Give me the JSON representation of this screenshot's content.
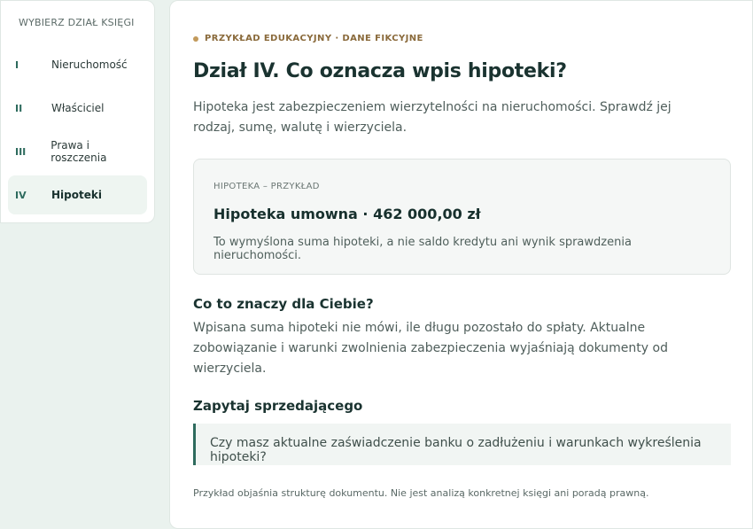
{
  "sidebar": {
    "title": "WYBIERZ DZIAŁ KSIĘGI",
    "items": [
      {
        "num": "I",
        "label": "Nieruchomość"
      },
      {
        "num": "II",
        "label": "Właściciel"
      },
      {
        "num": "III",
        "label": "Prawa i roszczenia"
      },
      {
        "num": "IV",
        "label": "Hipoteki",
        "active": true
      }
    ]
  },
  "main": {
    "eyebrow": "PRZYKŁAD EDUKACYJNY · DANE FIKCYJNE",
    "title": "Dział IV. Co oznacza wpis hipoteki?",
    "intro": "Hipoteka jest zabezpieczeniem wierzytelności na nieruchomości. Sprawdź jej rodzaj, sumę, walutę i wierzyciela.",
    "card": {
      "label": "HIPOTEKA – PRZYKŁAD",
      "title": "Hipoteka umowna · 462 000,00 zł",
      "note": "To wymyślona suma hipoteki, a nie saldo kredytu ani wynik sprawdzenia nieruchomości."
    },
    "section1": {
      "title": "Co to znaczy dla Ciebie?",
      "text": "Wpisana suma hipoteki nie mówi, ile długu pozostało do spłaty. Aktualne zobowiązanie i warunki zwolnienia zabezpieczenia wyjaśniają dokumenty od wierzyciela."
    },
    "section2": {
      "title": "Zapytaj sprzedającego",
      "quote": "Czy masz aktualne zaświadczenie banku o zadłużeniu i warunkach wykreślenia hipoteki?"
    },
    "footnote": "Przykład objaśnia strukturę dokumentu. Nie jest analizą konkretnej księgi ani poradą prawną."
  },
  "colors": {
    "accent": "#2e6b5e",
    "eyebrow": "#8a6a3b",
    "background": "#eaf2ee"
  }
}
